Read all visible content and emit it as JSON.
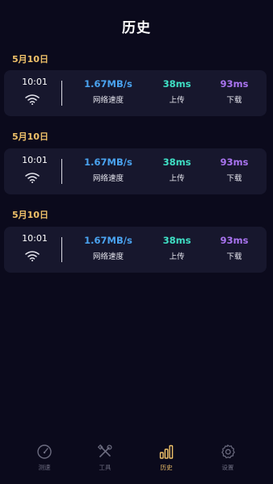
{
  "header": {
    "title": "历史"
  },
  "records": [
    {
      "date": "5月10日",
      "time": "10:01",
      "speed": "1.67MB/s",
      "speed_label": "网络速度",
      "upload": "38ms",
      "upload_label": "上传",
      "download": "93ms",
      "download_label": "下载"
    },
    {
      "date": "5月10日",
      "time": "10:01",
      "speed": "1.67MB/s",
      "speed_label": "网络速度",
      "upload": "38ms",
      "upload_label": "上传",
      "download": "93ms",
      "download_label": "下载"
    },
    {
      "date": "5月10日",
      "time": "10:01",
      "speed": "1.67MB/s",
      "speed_label": "网络速度",
      "upload": "38ms",
      "upload_label": "上传",
      "download": "93ms",
      "download_label": "下载"
    }
  ],
  "colors": {
    "background": "#0b0a1c",
    "card": "#17172d",
    "date": "#f0c26a",
    "speed": "#4aa3f0",
    "upload": "#3fe0c5",
    "download": "#a974f0",
    "tab_inactive": "#6c6c80",
    "tab_active": "#f0c26a"
  },
  "tabbar": {
    "items": [
      {
        "label": "测速",
        "icon": "speedometer-icon",
        "active": false
      },
      {
        "label": "工具",
        "icon": "tools-icon",
        "active": false
      },
      {
        "label": "历史",
        "icon": "bar-chart-icon",
        "active": true
      },
      {
        "label": "设置",
        "icon": "gear-icon",
        "active": false
      }
    ]
  }
}
